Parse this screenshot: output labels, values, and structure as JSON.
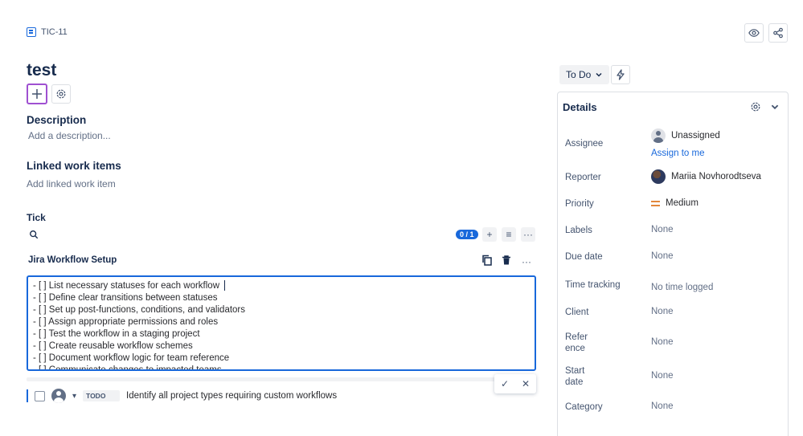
{
  "header": {
    "issue_key": "TIC-11",
    "watch_icon": "eye-icon",
    "share_icon": "share-icon"
  },
  "issue": {
    "title": "test",
    "add_icon": "plus-icon",
    "apps_icon": "gear-icon"
  },
  "description": {
    "title": "Description",
    "placeholder": "Add a description..."
  },
  "linked": {
    "title": "Linked work items",
    "placeholder": "Add linked work item"
  },
  "tick": {
    "title": "Tick",
    "count": "0 / 1",
    "add_label": "+",
    "filter_label": "≡",
    "more_label": "···",
    "checklist": {
      "title": "Jira Workflow Setup",
      "more_label": "···",
      "lines": [
        "- [ ] List necessary statuses for each workflow",
        "- [ ] Define clear transitions between statuses",
        "- [ ] Set up post-functions, conditions, and validators",
        "- [ ] Assign appropriate permissions and roles",
        "- [ ] Test the workflow in a staging project",
        "- [ ] Create reusable workflow schemes",
        "- [ ] Document workflow logic for team reference",
        "- [ ] Communicate changes to impacted teams"
      ],
      "confirm_label": "✓",
      "cancel_label": "✕"
    },
    "todo_item": {
      "status": "TODO",
      "text": "Identify all project types requiring custom workflows"
    }
  },
  "status": {
    "label": "To Do",
    "chevron": "chevron-down-icon",
    "automation_icon": "lightning-icon"
  },
  "details": {
    "title": "Details",
    "fields": {
      "assignee": {
        "label": "Assignee",
        "value": "Unassigned",
        "action": "Assign to me"
      },
      "reporter": {
        "label": "Reporter",
        "value": "Mariia Novhorodtseva"
      },
      "priority": {
        "label": "Priority",
        "value": "Medium",
        "color": "#e2873c"
      },
      "labels": {
        "label": "Labels",
        "value": "None"
      },
      "due_date": {
        "label": "Due date",
        "value": "None"
      },
      "time_tracking": {
        "label": "Time tracking",
        "value": "No time logged"
      },
      "client": {
        "label": "Client",
        "value": "None"
      },
      "reference": {
        "label_line1": "Refer",
        "label_line2": "ence",
        "value": "None"
      },
      "start_date": {
        "label_line1": "Start",
        "label_line2": "date",
        "value": "None"
      },
      "category": {
        "label": "Category",
        "value": "None"
      }
    }
  },
  "colors": {
    "accent": "#1868db",
    "focus_purple": "#9f50d1",
    "text": "#172b4d"
  }
}
